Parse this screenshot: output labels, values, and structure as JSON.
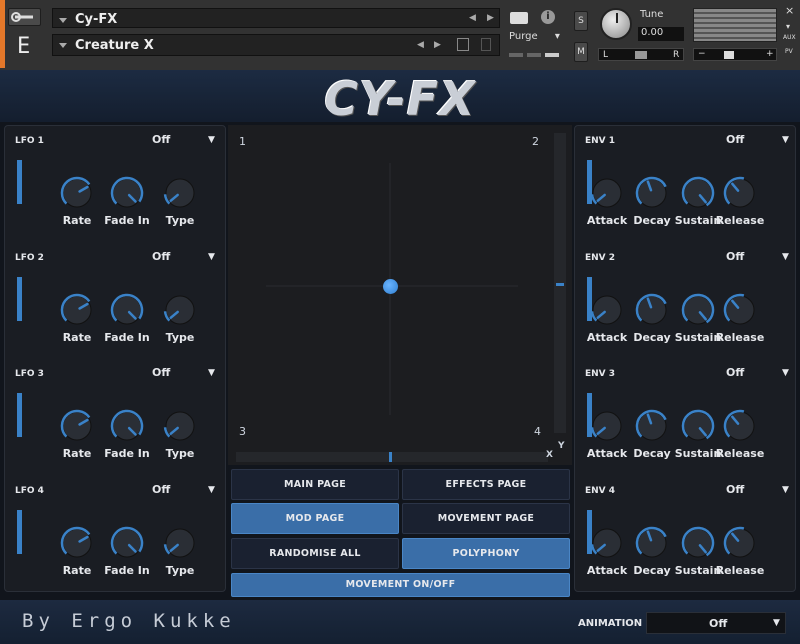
{
  "header": {
    "instrument_name": "Cy-FX",
    "snapshot_name": "Creature X",
    "purge_label": "Purge",
    "tune_label": "Tune",
    "tune_value": "0.00",
    "solo_label": "S",
    "mute_label": "M",
    "pan_left": "L",
    "pan_right": "R",
    "aux_label": "AUX",
    "pv_label": "PV",
    "close_label": "×",
    "minus": "−",
    "plus": "+",
    "info_label": "i"
  },
  "logo": "CY-FX",
  "lfo": [
    {
      "title": "LFO 1",
      "value": "Off"
    },
    {
      "title": "LFO 2",
      "value": "Off"
    },
    {
      "title": "LFO 3",
      "value": "Off"
    },
    {
      "title": "LFO 4",
      "value": "Off"
    }
  ],
  "lfo_knobs": [
    "Rate",
    "Fade In",
    "Type"
  ],
  "env": [
    {
      "title": "ENV 1",
      "value": "Off"
    },
    {
      "title": "ENV 2",
      "value": "Off"
    },
    {
      "title": "ENV 3",
      "value": "Off"
    },
    {
      "title": "ENV 4",
      "value": "Off"
    }
  ],
  "env_knobs": [
    "Attack",
    "Decay",
    "Sustain",
    "Release"
  ],
  "dropdown_arrow": "▼",
  "pad": {
    "c1": "1",
    "c2": "2",
    "c3": "3",
    "c4": "4",
    "x": "X",
    "y": "Y"
  },
  "buttons": {
    "main": "MAIN PAGE",
    "effects": "EFFECTS PAGE",
    "mod": "MOD PAGE",
    "movement": "MOVEMENT PAGE",
    "randomise": "RANDOMISE ALL",
    "polyphony": "POLYPHONY",
    "movement_onoff": "MOVEMENT ON/OFF"
  },
  "footer": {
    "credit": "By Ergo Kukke",
    "animation_label": "ANIMATION",
    "animation_value": "Off"
  },
  "colors": {
    "accent": "#3a82c8",
    "header_orange": "#e4782a"
  }
}
